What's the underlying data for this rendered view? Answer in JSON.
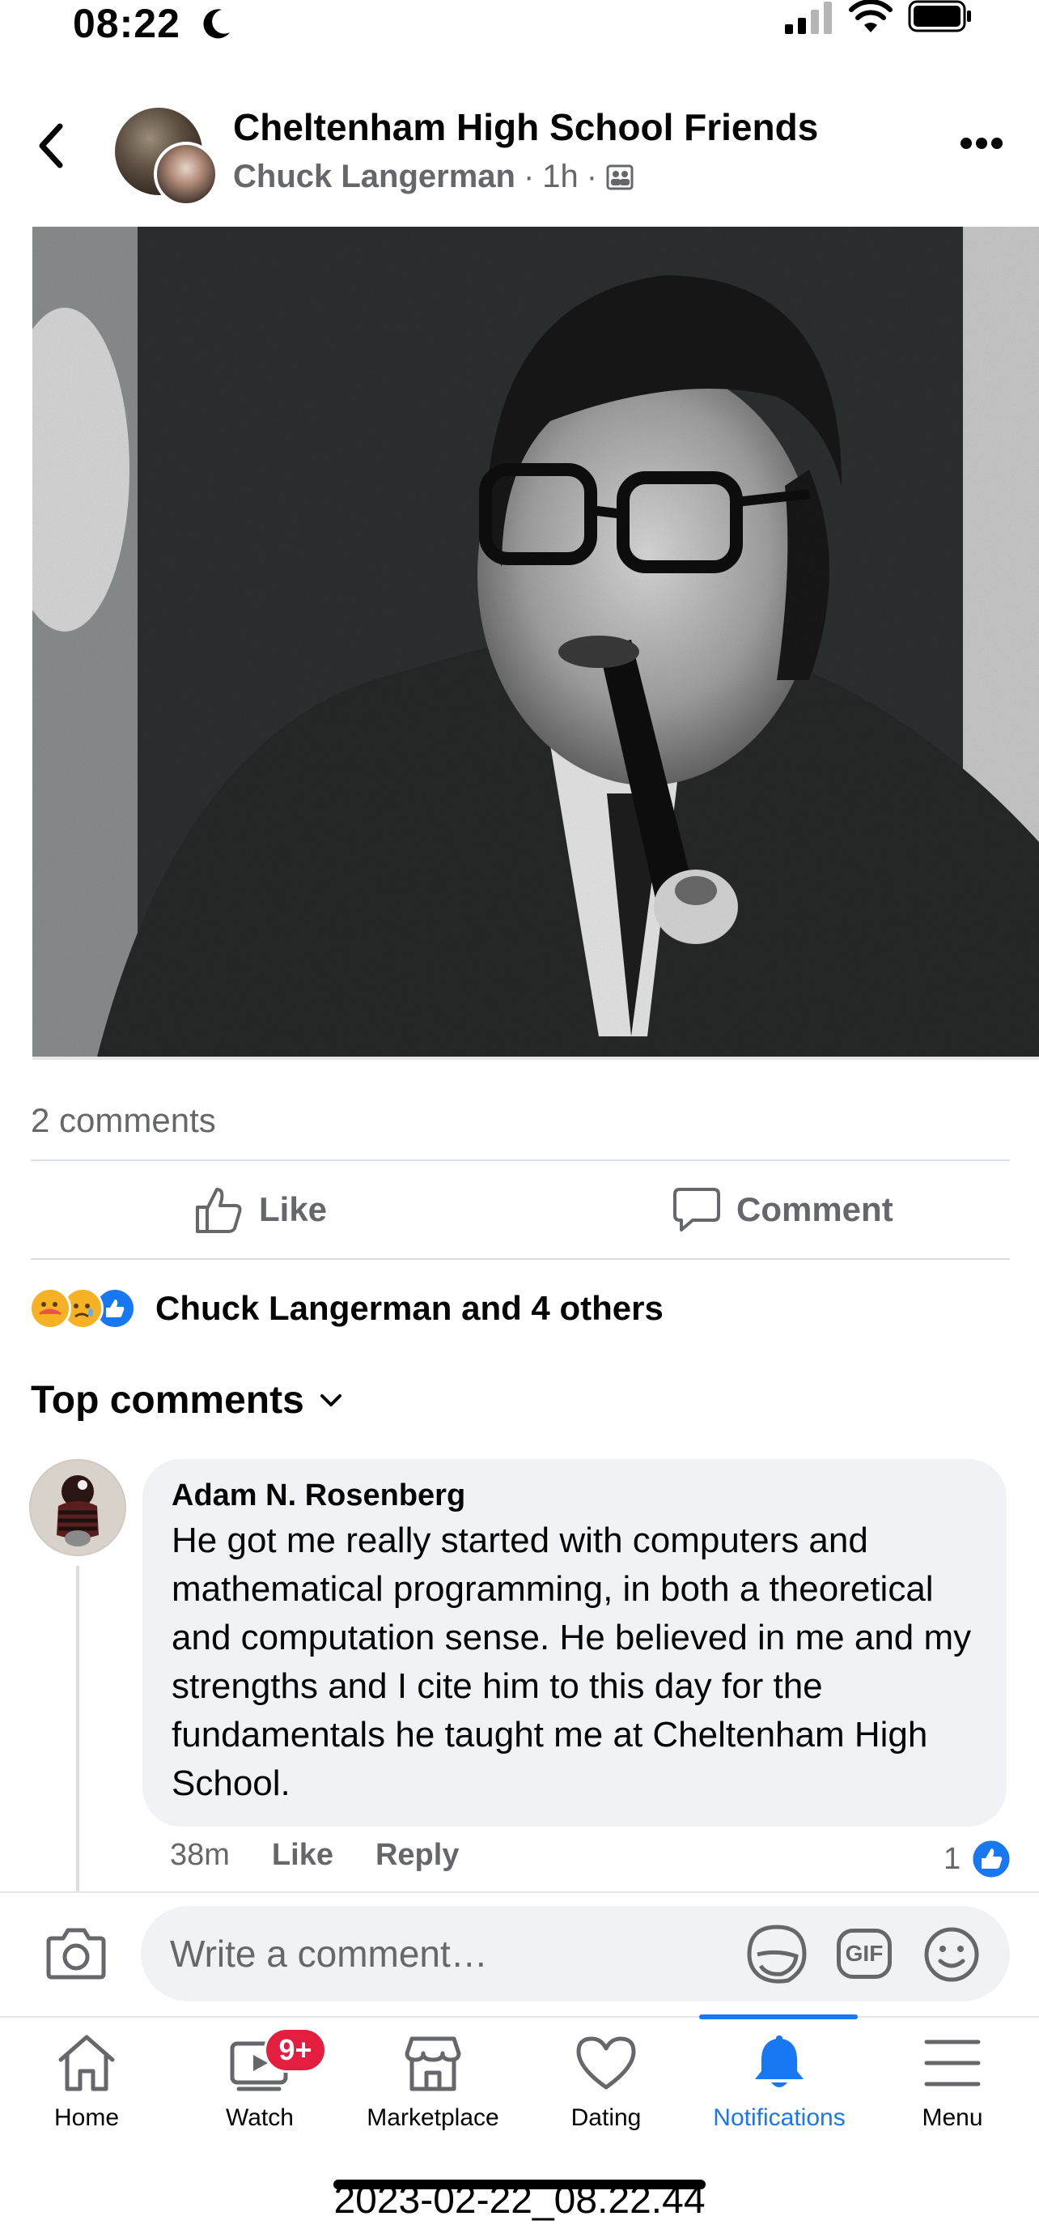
{
  "status_bar": {
    "time": "08:22"
  },
  "header": {
    "group_name": "Cheltenham High School Friends",
    "author": "Chuck Langerman",
    "separator": "·",
    "post_age": "1h"
  },
  "post": {
    "photo_alt": "",
    "comments_count": "2 comments",
    "like_label": "Like",
    "comment_label": "Comment",
    "reactions_text": "Chuck Langerman and 4 others"
  },
  "comments_section": {
    "sort_label": "Top comments",
    "comment": {
      "author": "Adam N. Rosenberg",
      "text": "He got me really started with computers and mathematical programming, in both a theoretical and computation sense. He believed in me and my strengths and I cite him to this day for the fundamentals he taught me at Cheltenham High School.",
      "age": "38m",
      "like_label": "Like",
      "reply_label": "Reply",
      "like_count": "1"
    }
  },
  "composer": {
    "placeholder": "Write a comment…",
    "gif_label": "GIF"
  },
  "tab_bar": {
    "items": [
      {
        "label": "Home",
        "icon": "home-icon"
      },
      {
        "label": "Watch",
        "icon": "watch-icon"
      },
      {
        "label": "Marketplace",
        "icon": "marketplace-icon"
      },
      {
        "label": "Dating",
        "icon": "dating-icon"
      },
      {
        "label": "Notifications",
        "icon": "notifications-icon"
      },
      {
        "label": "Menu",
        "icon": "menu-icon"
      }
    ],
    "active": "Notifications",
    "watch_badge": "9+"
  },
  "screenshot_caption": "2023-02-22_08.22.44",
  "colors": {
    "accent": "#1877f2",
    "badge": "#e41e3f",
    "secondary_text": "#65676b",
    "bubble": "#f0f2f5"
  }
}
